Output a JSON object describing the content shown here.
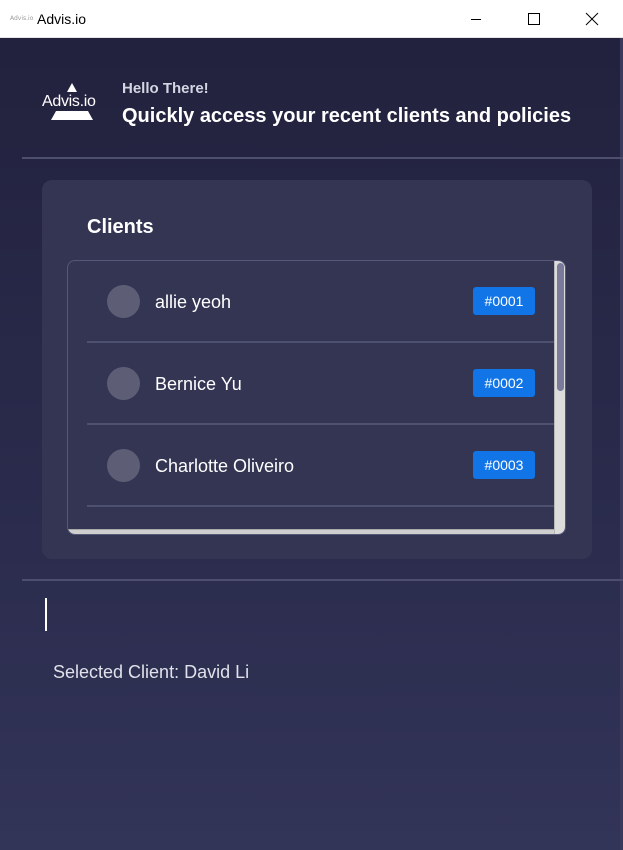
{
  "window": {
    "title": "Advis.io",
    "icon_text": "Advis.io"
  },
  "header": {
    "logo_text": "Advis.io",
    "greeting": "Hello There!",
    "headline": "Quickly access your recent clients and policies"
  },
  "clients": {
    "title": "Clients",
    "items": [
      {
        "name": "allie yeoh",
        "id": "#0001"
      },
      {
        "name": "Bernice Yu",
        "id": "#0002"
      },
      {
        "name": "Charlotte Oliveiro",
        "id": "#0003"
      },
      {
        "name": "",
        "id": ""
      }
    ]
  },
  "selection": {
    "label": "Selected Client: David Li"
  },
  "colors": {
    "background": "#2a2b4c",
    "card": "#333553",
    "badge": "#1175e8"
  }
}
